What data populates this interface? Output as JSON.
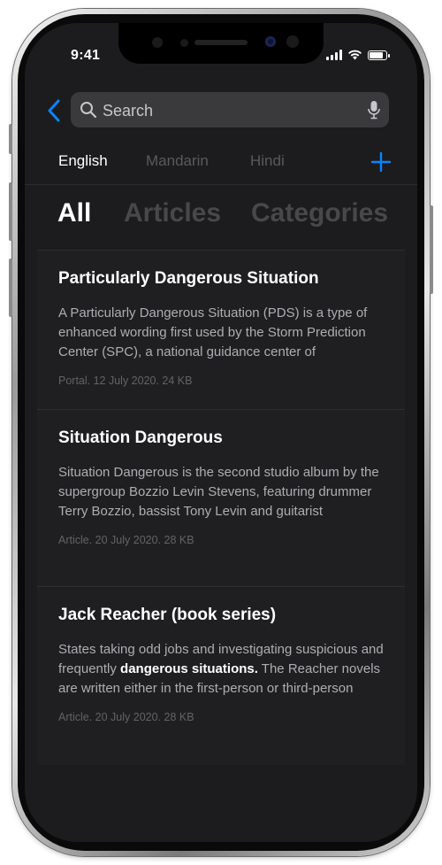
{
  "status_bar": {
    "time": "9:41"
  },
  "search": {
    "placeholder": "Search",
    "value": ""
  },
  "languages": [
    {
      "label": "English",
      "active": true
    },
    {
      "label": "Mandarin",
      "active": false
    },
    {
      "label": "Hindi",
      "active": false
    }
  ],
  "filters": [
    {
      "label": "All",
      "active": true
    },
    {
      "label": "Articles",
      "active": false
    },
    {
      "label": "Categories",
      "active": false
    }
  ],
  "results": [
    {
      "title": "Particularly Dangerous Situation",
      "snippet": "A Particularly Dangerous Situation (PDS) is a type of enhanced wording first used by the Storm Prediction Center (SPC), a national guidance center of",
      "meta": "Portal. 12 July 2020. 24 KB"
    },
    {
      "title": "Situation Dangerous",
      "snippet": "Situation Dangerous is the second studio album by the supergroup Bozzio Levin Stevens, featuring drummer Terry Bozzio, bassist Tony Levin and guitarist",
      "meta": "Article. 20 July 2020. 28 KB"
    },
    {
      "title": "Jack Reacher (book series)",
      "snippet_before": "States taking odd jobs and investigating suspicious and frequently ",
      "snippet_bold": "dangerous situations.",
      "snippet_after": " The Reacher novels are written either in the first-person or third-person",
      "meta": "Article. 20 July 2020. 28 KB"
    }
  ],
  "colors": {
    "accent": "#0a84ff",
    "background": "#1c1c1e",
    "card": "#1f1f21",
    "inactive_text": "#48484a"
  },
  "icons": [
    "back-chevron-icon",
    "search-icon",
    "microphone-icon",
    "plus-icon",
    "signal-icon",
    "wifi-icon",
    "battery-icon"
  ]
}
